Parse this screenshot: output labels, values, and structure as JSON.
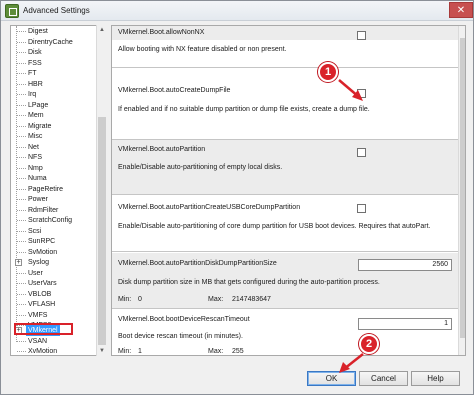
{
  "window": {
    "title": "Advanced Settings",
    "close_glyph": "✕",
    "icon": "app-icon"
  },
  "tree": {
    "items": [
      {
        "label": "Digest"
      },
      {
        "label": "DirentryCache"
      },
      {
        "label": "Disk"
      },
      {
        "label": "FSS"
      },
      {
        "label": "FT"
      },
      {
        "label": "HBR"
      },
      {
        "label": "Irq"
      },
      {
        "label": "LPage"
      },
      {
        "label": "Mem"
      },
      {
        "label": "Migrate"
      },
      {
        "label": "Misc"
      },
      {
        "label": "Net"
      },
      {
        "label": "NFS"
      },
      {
        "label": "Nmp"
      },
      {
        "label": "Numa"
      },
      {
        "label": "PageRetire"
      },
      {
        "label": "Power"
      },
      {
        "label": "RdmFilter"
      },
      {
        "label": "ScratchConfig"
      },
      {
        "label": "Scsi"
      },
      {
        "label": "SunRPC"
      },
      {
        "label": "SvMotion"
      },
      {
        "label": "Syslog"
      },
      {
        "label": "User"
      },
      {
        "label": "UserVars"
      },
      {
        "label": "VBLOB"
      },
      {
        "label": "VFLASH"
      },
      {
        "label": "VMFS"
      },
      {
        "label": "VMFS3"
      },
      {
        "label": "VMkernel"
      },
      {
        "label": "VSAN"
      },
      {
        "label": "XvMotion"
      }
    ],
    "selected": "VMkernel",
    "expand_glyph": "+"
  },
  "settings": [
    {
      "name": "VMkernel.Boot.allowNonNX",
      "description": "Allow booting with NX feature disabled or non present.",
      "control": "checkbox",
      "checked": false
    },
    {
      "name": "VMkernel.Boot.autoCreateDumpFile",
      "description": "If enabled and if no suitable dump partition or dump file exists, create a dump file.",
      "control": "checkbox",
      "checked": false
    },
    {
      "name": "VMkernel.Boot.autoPartition",
      "description": "Enable/Disable auto-partitioning of empty local disks.",
      "control": "checkbox",
      "checked": false
    },
    {
      "name": "VMkernel.Boot.autoPartitionCreateUSBCoreDumpPartition",
      "description": "Enable/Disable auto-partitioning of core dump partition for USB boot devices. Requires that autoPart.",
      "control": "checkbox",
      "checked": false
    },
    {
      "name": "VMkernel.Boot.autoPartitionDiskDumpPartitionSize",
      "description": "Disk dump partition size in MB that gets configured during the auto-partition process.",
      "control": "number",
      "value": "2560",
      "min_label": "Min:",
      "min": "0",
      "max_label": "Max:",
      "max": "2147483647"
    },
    {
      "name": "VMkernel.Boot.bootDeviceRescanTimeout",
      "description": "Boot device rescan timeout (in minutes).",
      "control": "number",
      "value": "1",
      "min_label": "Min:",
      "min": "1",
      "max_label": "Max:",
      "max": "255"
    }
  ],
  "buttons": {
    "ok": "OK",
    "cancel": "Cancel",
    "help": "Help"
  },
  "annotations": {
    "callout_1": "1",
    "callout_2": "2",
    "color": "#d9222a"
  }
}
